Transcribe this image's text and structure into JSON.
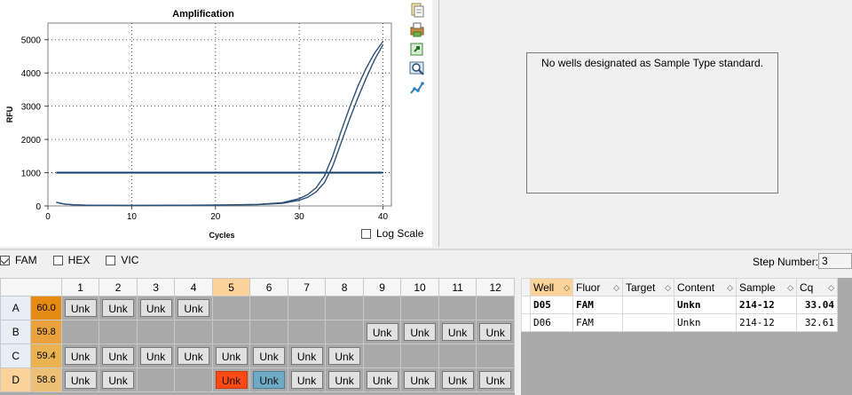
{
  "chart": {
    "title": "Amplification",
    "log_scale_label": "Log Scale",
    "log_scale_checked": false
  },
  "chart_data": {
    "type": "line",
    "title": "Amplification",
    "xlabel": "Cycles",
    "ylabel": "RFU",
    "xlim": [
      0,
      41
    ],
    "ylim": [
      0,
      5500
    ],
    "x_ticks": [
      0,
      10,
      20,
      30,
      40
    ],
    "y_ticks": [
      0,
      1000,
      2000,
      3000,
      4000,
      5000
    ],
    "grid": true,
    "threshold": 1000,
    "series": [
      {
        "values": [
          [
            1,
            110
          ],
          [
            2,
            55
          ],
          [
            3,
            35
          ],
          [
            5,
            20
          ],
          [
            10,
            15
          ],
          [
            20,
            25
          ],
          [
            25,
            45
          ],
          [
            28,
            100
          ],
          [
            30,
            220
          ],
          [
            31,
            340
          ],
          [
            32,
            540
          ],
          [
            33,
            900
          ],
          [
            34,
            1500
          ],
          [
            35,
            2250
          ],
          [
            36,
            2950
          ],
          [
            37,
            3600
          ],
          [
            38,
            4150
          ],
          [
            39,
            4600
          ],
          [
            40,
            4950
          ]
        ]
      },
      {
        "values": [
          [
            1,
            110
          ],
          [
            2,
            55
          ],
          [
            3,
            35
          ],
          [
            5,
            20
          ],
          [
            10,
            15
          ],
          [
            20,
            25
          ],
          [
            25,
            40
          ],
          [
            28,
            80
          ],
          [
            30,
            170
          ],
          [
            31,
            260
          ],
          [
            32,
            420
          ],
          [
            33,
            700
          ],
          [
            34,
            1200
          ],
          [
            35,
            1900
          ],
          [
            36,
            2600
          ],
          [
            37,
            3250
          ],
          [
            38,
            3850
          ],
          [
            39,
            4400
          ],
          [
            40,
            4850
          ]
        ]
      }
    ],
    "colors": {
      "series": "#2a4f78",
      "threshold": "#0f3d6e"
    }
  },
  "standards_message": "No wells designated as Sample Type standard.",
  "fluors": [
    {
      "label": "FAM",
      "checked": true
    },
    {
      "label": "HEX",
      "checked": false
    },
    {
      "label": "VIC",
      "checked": false
    }
  ],
  "step": {
    "label": "Step Number:",
    "value": "3"
  },
  "plate": {
    "columns": [
      "1",
      "2",
      "3",
      "4",
      "5",
      "6",
      "7",
      "8",
      "9",
      "10",
      "11",
      "12"
    ],
    "selected_column": "5",
    "rows": [
      {
        "label": "A",
        "temp": "60.0",
        "temp_color": "#e58a12",
        "cells": [
          "Unk",
          "Unk",
          "Unk",
          "Unk",
          "",
          "",
          "",
          "",
          "",
          "",
          "",
          ""
        ]
      },
      {
        "label": "B",
        "temp": "59.8",
        "temp_color": "#e9a23d",
        "cells": [
          "",
          "",
          "",
          "",
          "",
          "",
          "",
          "",
          "Unk",
          "Unk",
          "Unk",
          "Unk"
        ]
      },
      {
        "label": "C",
        "temp": "59.4",
        "temp_color": "#ebb252",
        "cells": [
          "Unk",
          "Unk",
          "Unk",
          "Unk",
          "Unk",
          "Unk",
          "Unk",
          "Unk",
          "",
          "",
          "",
          ""
        ]
      },
      {
        "label": "D",
        "temp": "58.6",
        "temp_color": "#ecc075",
        "cells": [
          "Unk",
          "Unk",
          "",
          "",
          "Unk",
          "Unk",
          "Unk",
          "Unk",
          "Unk",
          "Unk",
          "Unk",
          "Unk"
        ],
        "selected": true,
        "highlight": {
          "4": "red",
          "5": "blue"
        }
      }
    ]
  },
  "results": {
    "headers": [
      "Well",
      "Fluor",
      "Target",
      "Content",
      "Sample",
      "Cq"
    ],
    "rows": [
      {
        "well": "D05",
        "fluor": "FAM",
        "target": "",
        "content": "Unkn",
        "sample": "214-12",
        "cq": "33.04",
        "bold": true
      },
      {
        "well": "D06",
        "fluor": "FAM",
        "target": "",
        "content": "Unkn",
        "sample": "214-12",
        "cq": "32.61",
        "bold": false
      }
    ]
  }
}
